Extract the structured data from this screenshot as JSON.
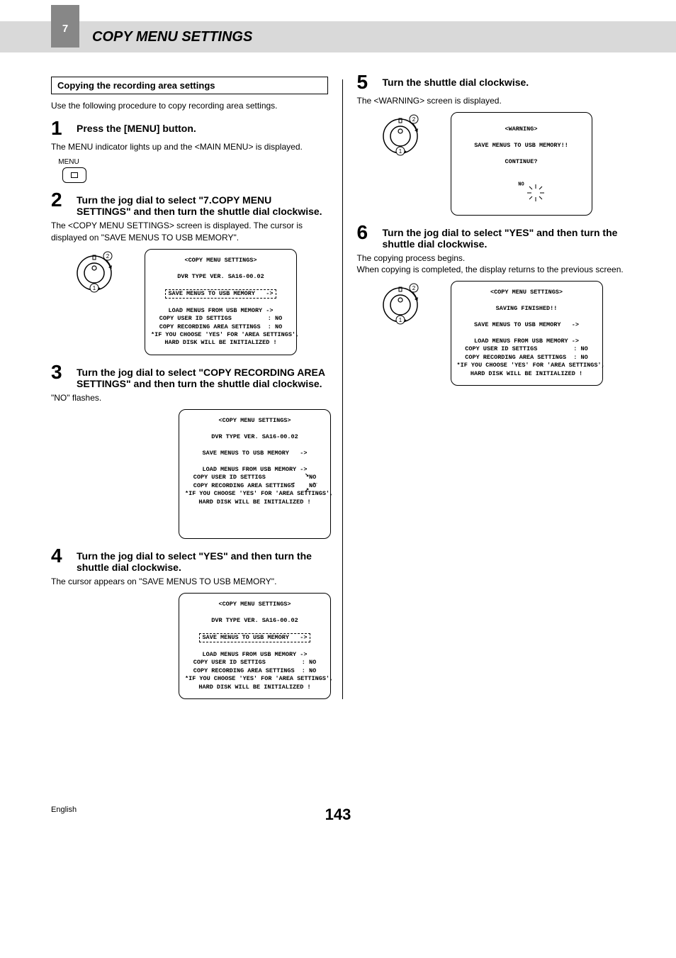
{
  "header": {
    "chapter_num": "7",
    "title": "COPY MENU SETTINGS"
  },
  "left": {
    "section_box": "Copying the recording area settings",
    "intro": "Use the following procedure to copy recording area settings.",
    "step1": {
      "num": "1",
      "head": "Press the [MENU] button.",
      "body": "The MENU indicator lights up and the <MAIN MENU> is displayed.",
      "menu_label": "MENU"
    },
    "step2": {
      "num": "2",
      "head": "Turn the jog dial to select \"7.COPY MENU SETTINGS\" and then turn the shuttle dial clockwise.",
      "body": "The <COPY MENU SETTINGS> screen is displayed. The cursor is displayed on \"SAVE MENUS TO USB MEMORY\".",
      "lcd_title": "<COPY MENU SETTINGS>",
      "lcd_ver": "DVR TYPE VER. SA16-00.02",
      "lcd_save": "SAVE MENUS TO USB MEMORY   ->",
      "lcd_line1": "LOAD MENUS FROM USB MEMORY ->",
      "lcd_line2": "COPY USER ID SETTIGS          : NO",
      "lcd_line3": "COPY RECORDING AREA SETTINGS  : NO",
      "lcd_line4": "*IF YOU CHOOSE 'YES' FOR 'AREA SETTINGS',",
      "lcd_line5": "HARD DISK WILL BE INITIALIZED !"
    },
    "step3": {
      "num": "3",
      "head": "Turn the jog dial to select \"COPY RECORDING AREA SETTINGS\" and then turn the shuttle dial clockwise.",
      "body": "\"NO\" flashes.",
      "lcd_title": "<COPY MENU SETTINGS>",
      "lcd_ver": "DVR TYPE VER. SA16-00.02",
      "lcd_save": "SAVE MENUS TO USB MEMORY   ->",
      "lcd_line1": "LOAD MENUS FROM USB MEMORY ->",
      "lcd_line2": "COPY USER ID SETTIGS            NO",
      "lcd_line3": "COPY RECORDING AREA SETTINGS    NO",
      "lcd_line4": "*IF YOU CHOOSE 'YES' FOR 'AREA SETTINGS',",
      "lcd_line5": "HARD DISK WILL BE INITIALIZED !",
      "no_label": "NO"
    },
    "step4": {
      "num": "4",
      "head": "Turn the jog dial to select \"YES\" and then turn the shuttle dial clockwise.",
      "body": "The cursor appears on \"SAVE MENUS TO USB MEMORY\".",
      "lcd_title": "<COPY MENU SETTINGS>",
      "lcd_ver": "DVR TYPE VER. SA16-00.02",
      "lcd_save": "SAVE MENUS TO USB MEMORY   ->",
      "lcd_line1": "LOAD MENUS FROM USB MEMORY ->",
      "lcd_line2": "COPY USER ID SETTIGS          : NO",
      "lcd_line3": "COPY RECORDING AREA SETTINGS  : NO",
      "lcd_line4": "*IF YOU CHOOSE 'YES' FOR 'AREA SETTINGS',",
      "lcd_line5": "HARD DISK WILL BE INITIALIZED !"
    }
  },
  "right": {
    "step5": {
      "num": "5",
      "head": "Turn the shuttle dial clockwise.",
      "body": "The <WARNING> screen is displayed.",
      "lcd_title": "<WARNING>",
      "lcd_line1": "SAVE MENUS TO USB MEMORY!!",
      "lcd_line2": "CONTINUE?",
      "no_label": "NO"
    },
    "step6": {
      "num": "6",
      "head": "Turn the jog dial to select \"YES\" and then turn the shuttle dial clockwise.",
      "body": "The copying process begins.\nWhen copying is completed, the display returns to the previous screen.",
      "lcd_title": "<COPY MENU SETTINGS>",
      "lcd_saving": "SAVING FINISHED!!",
      "lcd_save": "SAVE MENUS TO USB MEMORY   ->",
      "lcd_line1": "LOAD MENUS FROM USB MEMORY ->",
      "lcd_line2": "COPY USER ID SETTIGS          : NO",
      "lcd_line3": "COPY RECORDING AREA SETTINGS  : NO",
      "lcd_line4": "*IF YOU CHOOSE 'YES' FOR 'AREA SETTINGS',",
      "lcd_line5": "HARD DISK WILL BE INITIALIZED !"
    }
  },
  "footer": {
    "lang": "English",
    "page": "143"
  },
  "dial": {
    "label1": "1",
    "label2": "2"
  }
}
